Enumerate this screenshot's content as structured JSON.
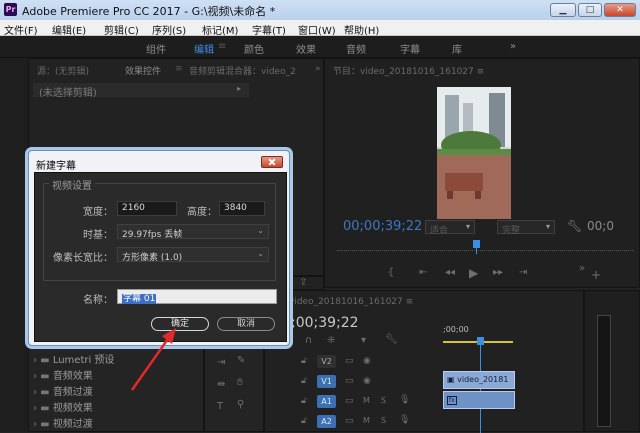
{
  "window": {
    "app_icon": "Pr",
    "title": "Adobe Premiere Pro CC 2017 - G:\\视频\\未命名 *",
    "min_label": "▁",
    "max_label": "□",
    "close_label": "✕"
  },
  "menu": [
    "文件(F)",
    "编辑(E)",
    "剪辑(C)",
    "序列(S)",
    "标记(M)",
    "字幕(T)",
    "窗口(W)",
    "帮助(H)"
  ],
  "workspaces": [
    "组件",
    "编辑",
    "颜色",
    "效果",
    "音频",
    "字幕",
    "库",
    "»"
  ],
  "workspace_active": "编辑",
  "source_panel": {
    "tabs": [
      "源：(无剪辑)",
      "效果控件",
      "音频剪辑混合器：video_2",
      "»"
    ],
    "no_clip_label": "(未选择剪辑)"
  },
  "program_monitor": {
    "header": "节目：video_20181016_161027 ≡",
    "timecode": "00;00;39;22",
    "fit": "适合",
    "quality": "完整",
    "end_timecode": "00;0"
  },
  "dialog": {
    "title": "新建字幕",
    "group_label": "视频设置",
    "width_label": "宽度：",
    "width_value": "2160",
    "height_label": "高度：",
    "height_value": "3840",
    "timebase_label": "时基：",
    "timebase_value": "29.97fps 丢帧",
    "pixel_aspect_label": "像素长宽比：",
    "pixel_aspect_value": "方形像素 (1.0)",
    "name_label": "名称：",
    "name_value": "字幕 01",
    "ok_label": "确定",
    "cancel_label": "取消"
  },
  "timeline": {
    "tab": "video_20181016_161027 ≡",
    "timecode": ";00;39;22",
    "ruler_label": ";00;00",
    "tracks": [
      {
        "name": "V2"
      },
      {
        "name": "V1",
        "clip": "video_20181"
      },
      {
        "name": "A1",
        "clip": "fx"
      },
      {
        "name": "A2"
      }
    ],
    "track_labels": [
      "M",
      "S"
    ]
  },
  "project_panel": {
    "items": [
      "Lumetri 预设",
      "音频效果",
      "音频过渡",
      "视频效果",
      "视频过渡"
    ]
  },
  "colors": {
    "accent": "#3d8ee5",
    "arrow": "#e02a2a",
    "clip": "#8aa9d7"
  }
}
